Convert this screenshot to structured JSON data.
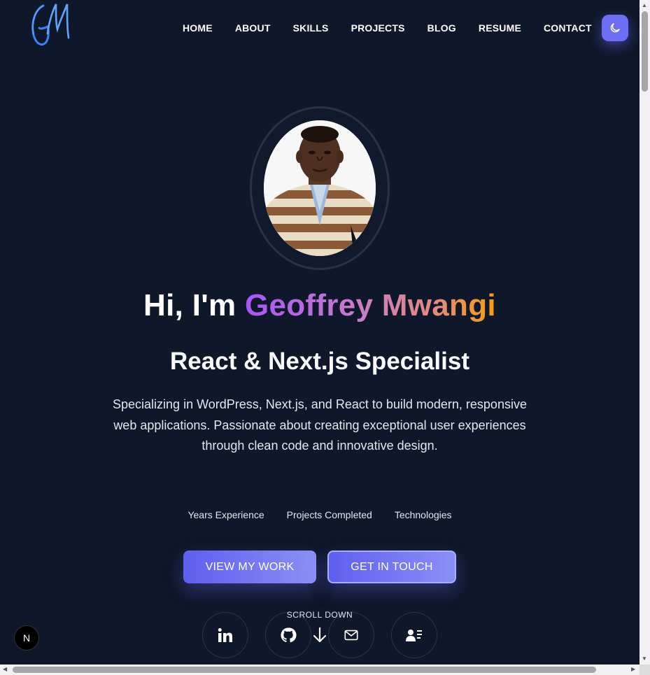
{
  "nav": {
    "logo_text": "GM",
    "items": [
      "HOME",
      "ABOUT",
      "SKILLS",
      "PROJECTS",
      "BLOG",
      "RESUME",
      "CONTACT"
    ]
  },
  "hero": {
    "greeting": "Hi, I'm ",
    "name": "Geoffrey Mwangi",
    "role": "React & Next.js Specialist",
    "description": "Specializing in WordPress, Next.js, and React to build modern, responsive web applications. Passionate about creating exceptional user experiences through clean code and innovative design.",
    "stats": [
      "Years Experience",
      "Projects Completed",
      "Technologies"
    ],
    "primary_button": "VIEW MY WORK",
    "secondary_button": "GET IN TOUCH",
    "scroll_label": "SCROLL DOWN"
  },
  "social": [
    "linkedin-icon",
    "github-icon",
    "mail-icon",
    "contact-card-icon"
  ],
  "badge": {
    "label": "N"
  },
  "colors": {
    "background": "#0f172a",
    "accent": "#6366f1",
    "gradient_start": "#a855f7",
    "gradient_end": "#f59e0b"
  }
}
